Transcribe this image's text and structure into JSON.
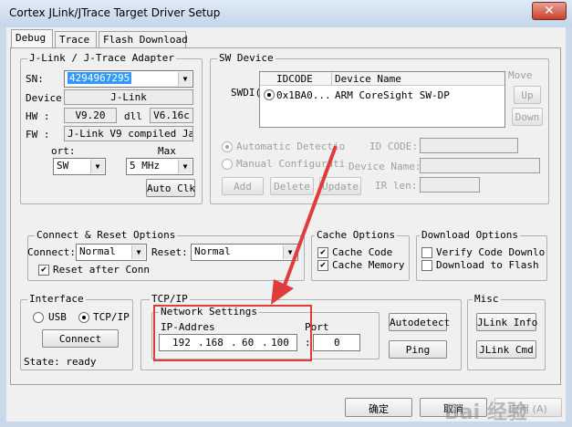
{
  "window": {
    "title": "Cortex JLink/JTrace Target Driver Setup",
    "close_glyph": "✕"
  },
  "tabs": [
    "Debug",
    "Trace",
    "Flash Download"
  ],
  "jlink": {
    "title": "J-Link / J-Trace Adapter",
    "sn_label": "SN:",
    "sn_value": "4294967295",
    "device_label": "Device:",
    "device_value": "J-Link",
    "hw_label": "HW :",
    "hw_value": "V9.20",
    "dll_label": "dll",
    "dll_value": "V6.16c",
    "fw_label": "FW :",
    "fw_value": "J-Link V9 compiled Jan :",
    "port_label": "ort:",
    "port_value": "SW",
    "max_label": "Max",
    "max_value": "5 MHz",
    "autoclk_label": "Auto Clk"
  },
  "sw_device": {
    "title": "SW Device",
    "swdi_label": "SWDI(",
    "col_idcode": "IDCODE",
    "col_device": "Device Name",
    "row_idcode": "0x1BA0...",
    "row_device": "ARM CoreSight SW-DP",
    "move_label": "Move",
    "up_label": "Up",
    "down_label": "Down",
    "auto_detect": "Automatic Detectio",
    "manual_config": "Manual Configurati",
    "id_code_label": "ID CODE:",
    "device_name_label": "Device Name:",
    "ir_len_label": "IR len:",
    "add_label": "Add",
    "delete_label": "Delete",
    "update_label": "Update"
  },
  "connect_reset": {
    "title": "Connect & Reset Options",
    "connect_label": "Connect:",
    "connect_value": "Normal",
    "reset_label": "Reset:",
    "reset_value": "Normal",
    "reset_after": "Reset after Conn"
  },
  "cache": {
    "title": "Cache Options",
    "code": "Cache Code",
    "memory": "Cache Memory"
  },
  "download": {
    "title": "Download Options",
    "verify": "Verify Code Downlo",
    "to_flash": "Download to Flash"
  },
  "interface": {
    "title": "Interface",
    "usb": "USB",
    "tcpip": "TCP/IP",
    "connect_btn": "Connect",
    "state": "State: ready"
  },
  "tcpip": {
    "title": "TCP/IP",
    "network_title": "Network Settings",
    "ip_label": "IP-Addres",
    "ip": [
      "192",
      "168",
      "60",
      "100"
    ],
    "port_label": "Port",
    "port_value": "0",
    "autodetect": "Autodetect",
    "ping": "Ping"
  },
  "misc": {
    "title": "Misc",
    "jlink_info": "JLink Info",
    "jlink_cmd": "JLink Cmd"
  },
  "footer": {
    "ok": "确定",
    "cancel": "取消",
    "apply": "应用 (A)"
  },
  "watermark": "Bai 经验",
  "colors": {
    "accent_red": "#e03c3c",
    "selection": "#3399ff"
  }
}
